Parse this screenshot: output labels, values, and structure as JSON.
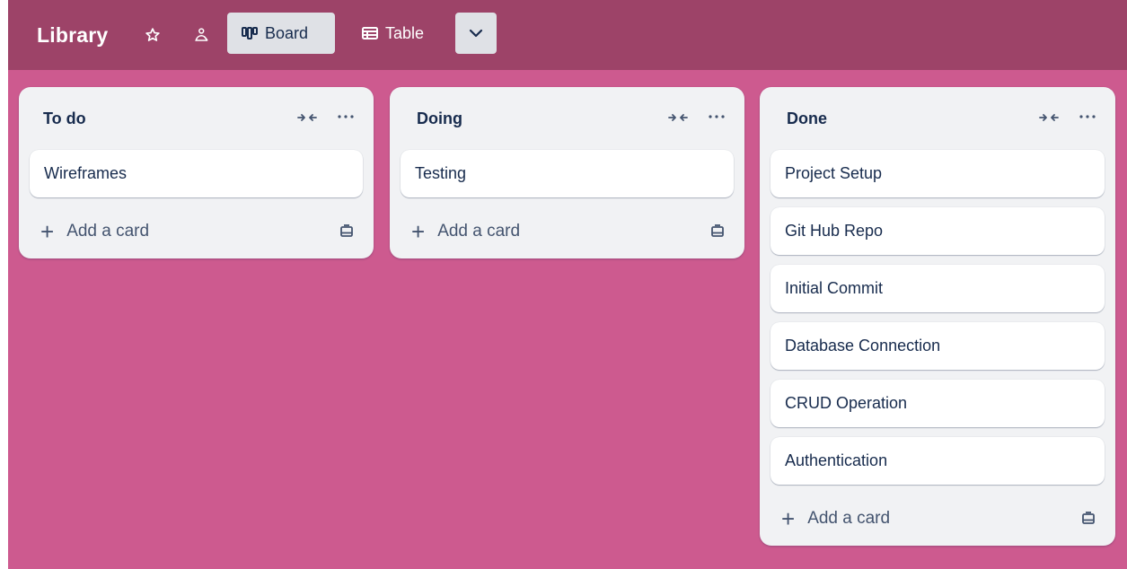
{
  "board": {
    "title": "Library",
    "views": {
      "board_label": "Board",
      "table_label": "Table"
    }
  },
  "lists": [
    {
      "title": "To do",
      "cards": [
        "Wireframes"
      ],
      "add_label": "Add a card"
    },
    {
      "title": "Doing",
      "cards": [
        "Testing"
      ],
      "add_label": "Add a card"
    },
    {
      "title": "Done",
      "cards": [
        "Project Setup",
        "Git Hub Repo",
        "Initial Commit",
        "Database Connection",
        "CRUD Operation",
        "Authentication"
      ],
      "add_label": "Add a card"
    }
  ],
  "colors": {
    "header_bg": "#9d4368",
    "board_bg": "#cd5a8f",
    "list_bg": "#f1f2f4",
    "card_bg": "#ffffff",
    "text": "#172b4d"
  },
  "icons": {
    "star": "star-icon",
    "visibility": "team-visibility-icon",
    "board_view": "board-view-icon",
    "table_view": "table-view-icon",
    "dropdown": "chevron-down-icon",
    "collapse": "collapse-list-icon",
    "more": "more-horizontal-icon",
    "add": "plus-icon",
    "template": "card-template-icon"
  }
}
